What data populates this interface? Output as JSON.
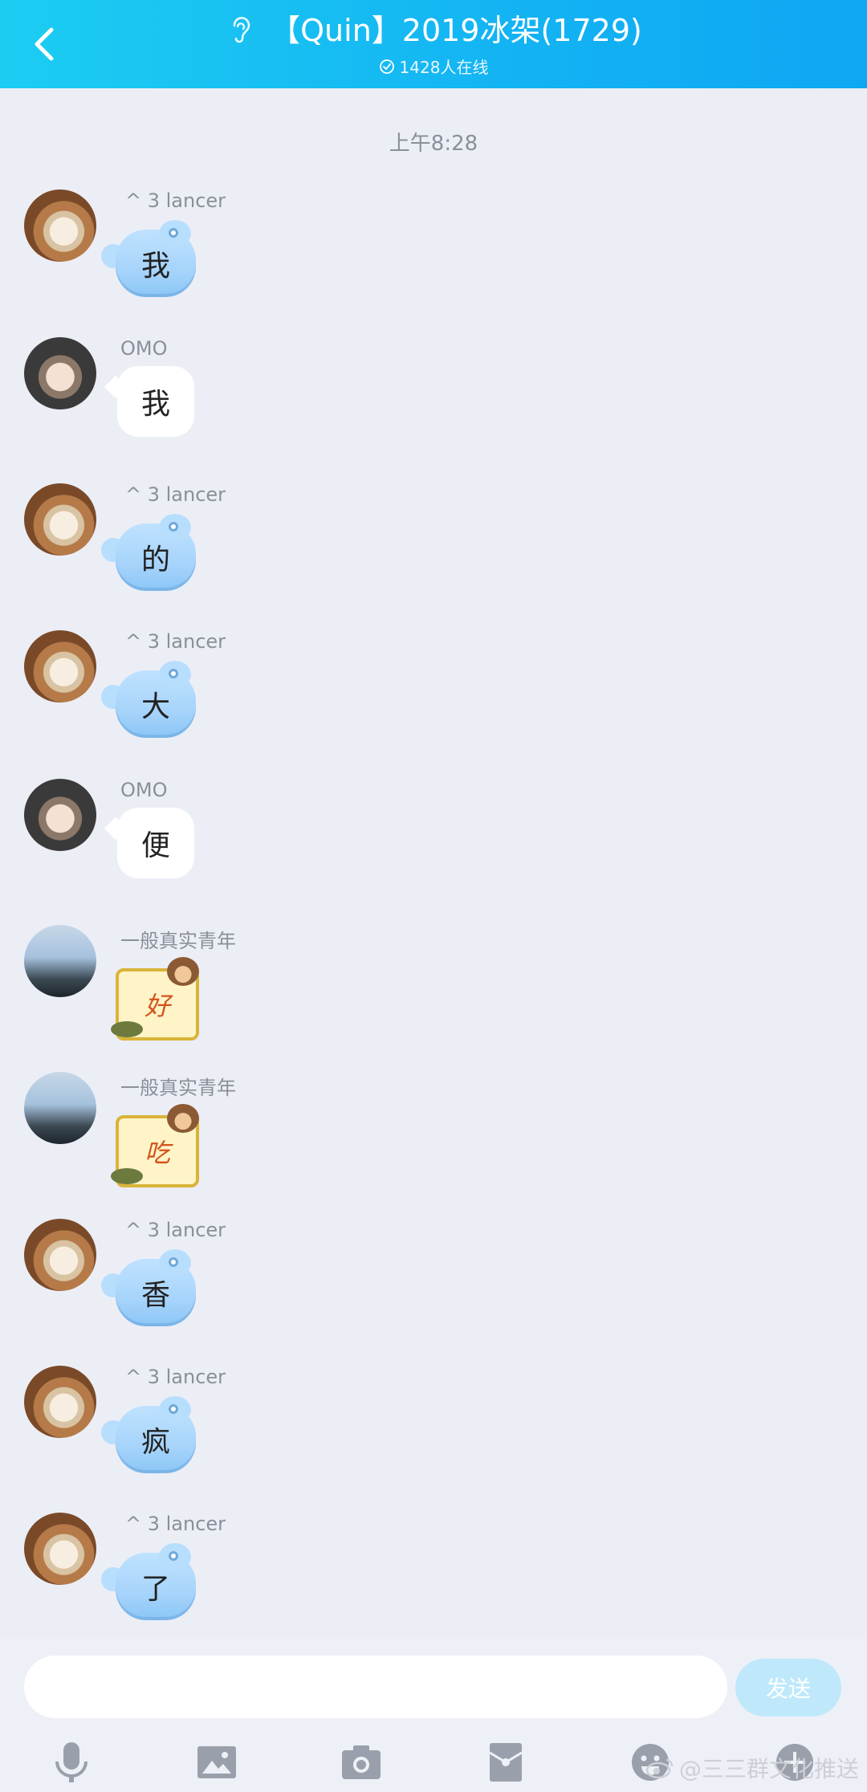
{
  "header": {
    "title": "【Quin】2019冰架(1729)",
    "online": "1428人在线"
  },
  "time_label": "上午8:28",
  "messages": [
    {
      "sender": "^ 3 lancer",
      "avatar": "cat-avatar",
      "type": "bubble-blue",
      "text": "我"
    },
    {
      "sender": "OMO",
      "avatar": "anime-avatar",
      "type": "bubble-white",
      "text": "我"
    },
    {
      "sender": "^ 3 lancer",
      "avatar": "cat-avatar",
      "type": "bubble-blue",
      "text": "的"
    },
    {
      "sender": "^ 3 lancer",
      "avatar": "cat-avatar",
      "type": "bubble-blue",
      "text": "大"
    },
    {
      "sender": "OMO",
      "avatar": "anime-avatar",
      "type": "bubble-white",
      "text": "便"
    },
    {
      "sender": "一般真实青年",
      "avatar": "sky-avatar",
      "type": "sticker",
      "text": "好"
    },
    {
      "sender": "一般真实青年",
      "avatar": "sky-avatar",
      "type": "sticker",
      "text": "吃"
    },
    {
      "sender": "^ 3 lancer",
      "avatar": "cat-avatar",
      "type": "bubble-blue",
      "text": "香"
    },
    {
      "sender": "^ 3 lancer",
      "avatar": "cat-avatar",
      "type": "bubble-blue",
      "text": "疯"
    },
    {
      "sender": "^ 3 lancer",
      "avatar": "cat-avatar",
      "type": "bubble-blue",
      "text": "了"
    }
  ],
  "composer": {
    "placeholder": "",
    "send_label": "发送"
  },
  "toolbar_icons": [
    "microphone-icon",
    "image-icon",
    "camera-icon",
    "red-packet-icon",
    "emoji-icon",
    "plus-icon"
  ],
  "watermark": "@三三群文化推送",
  "colors": {
    "header_start": "#1ccdf2",
    "header_end": "#0ea7f3",
    "background": "#eceef6",
    "send_button": "#bfe9fb"
  }
}
